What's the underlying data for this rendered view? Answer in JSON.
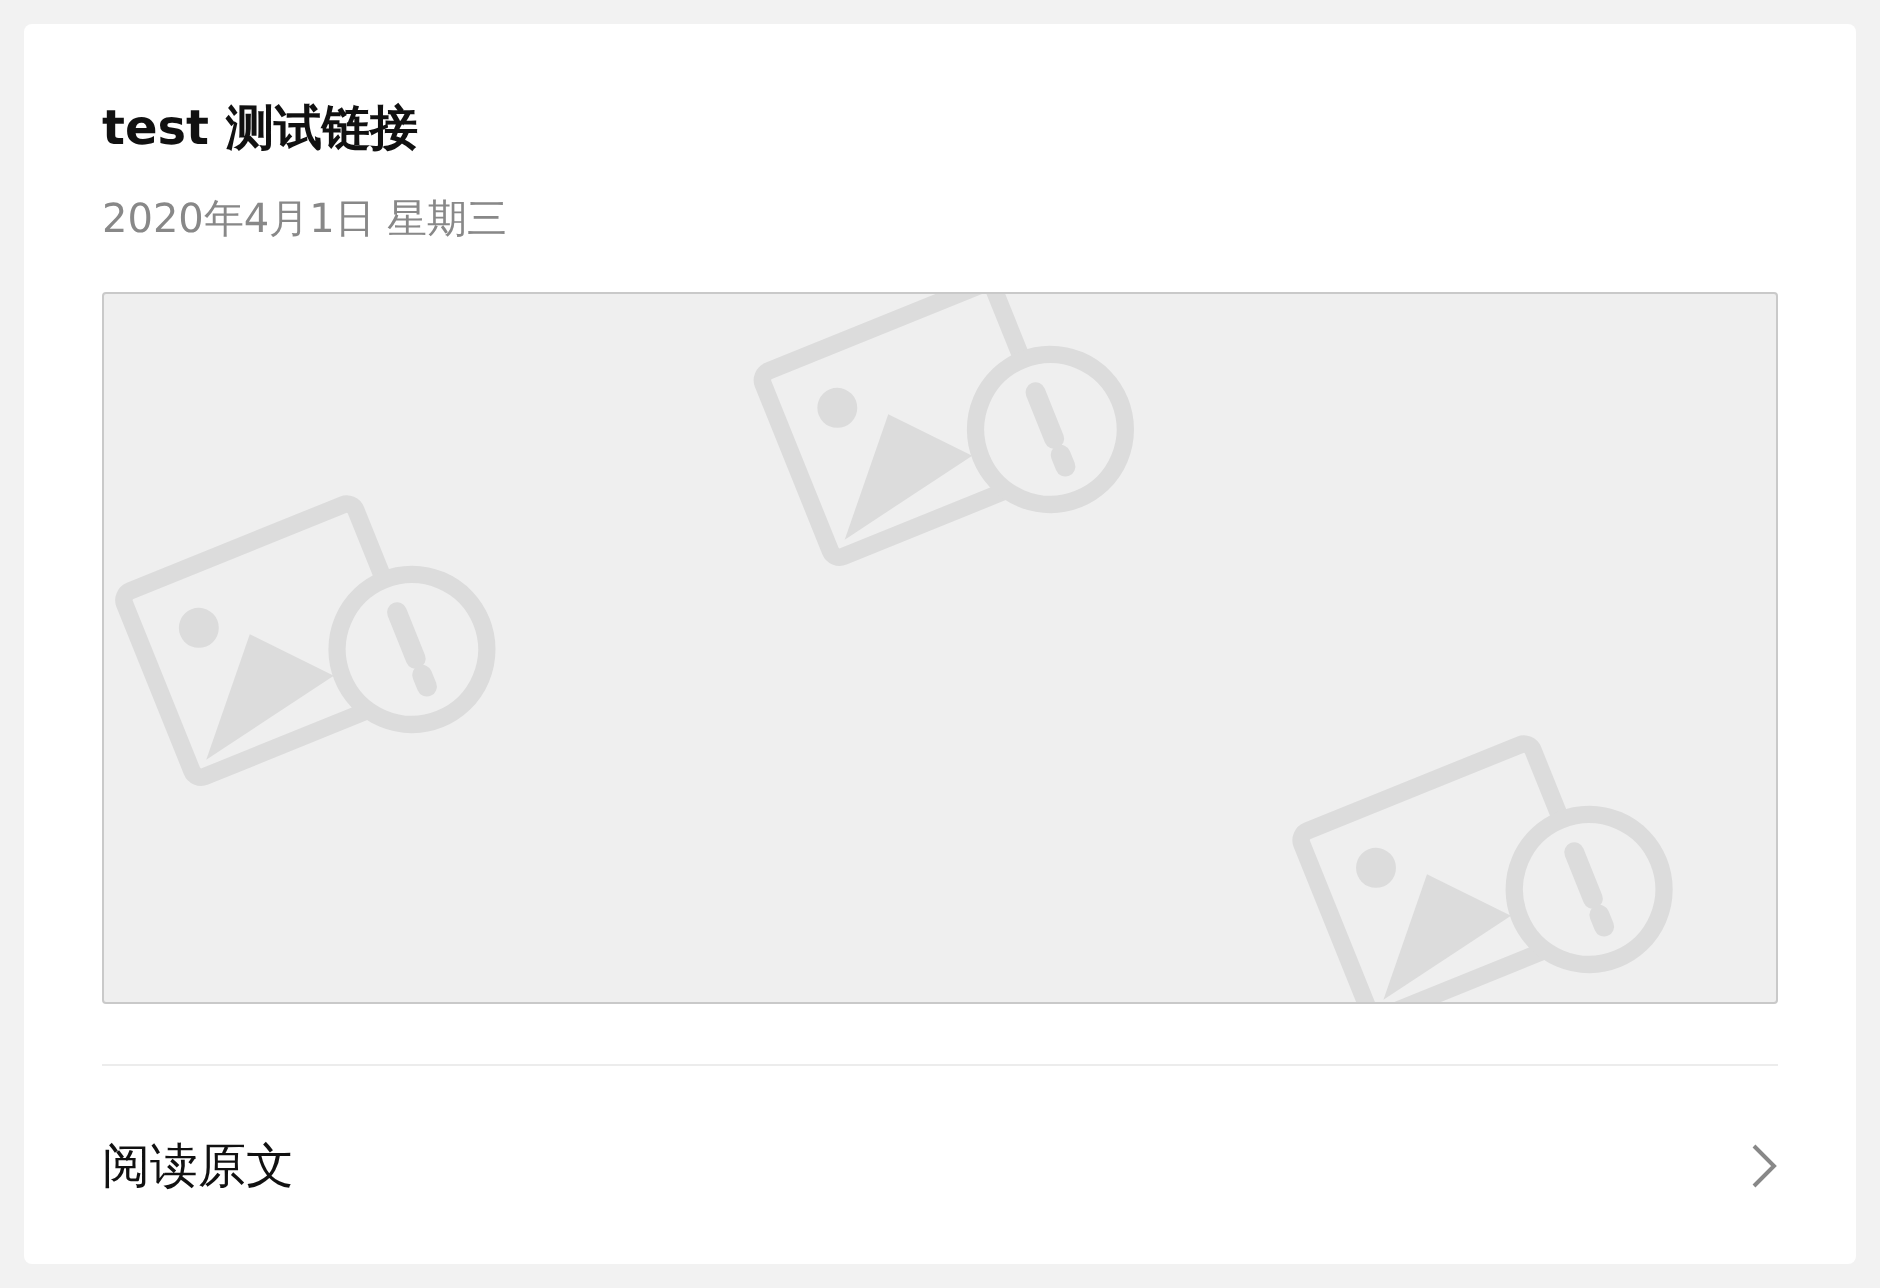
{
  "article": {
    "title": "test 测试链接",
    "date": "2020年4月1日 星期三",
    "image": {
      "kind": "placeholder"
    }
  },
  "footer": {
    "link": "阅读原文"
  }
}
